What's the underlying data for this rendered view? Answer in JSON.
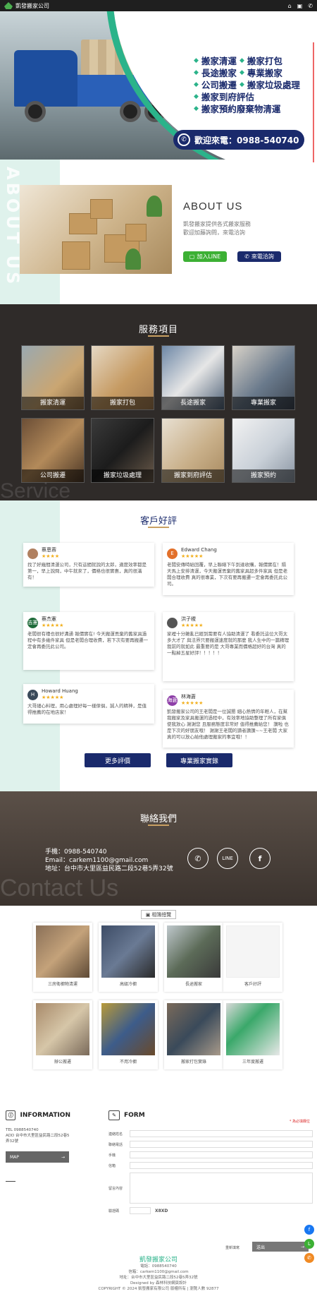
{
  "header": {
    "logo_text": "凱發搬家公司",
    "icons": [
      "home-icon",
      "gallery-icon",
      "share-icon"
    ]
  },
  "hero": {
    "services": [
      [
        "搬家清運",
        "搬家打包"
      ],
      [
        "長途搬家",
        "專業搬家"
      ],
      [
        "公司搬遷",
        "搬家垃圾處理"
      ],
      [
        "搬家到府評估"
      ],
      [
        "搬家預約廢棄物清運"
      ]
    ],
    "phone_label": "歡迎來電：0988-540740"
  },
  "about": {
    "watermark": "ABOUT US",
    "title": "ABOUT US",
    "desc_line1": "凱發搬家提供各式搬家服務",
    "desc_line2": "歡迎加藤詢問，來電洽詢",
    "line_button": "加入LINE",
    "call_button": "來電洽詢"
  },
  "services": {
    "title": "服務項目",
    "watermark": "Service",
    "items": [
      "搬家清運",
      "搬家打包",
      "長途搬家",
      "專業搬家",
      "公司搬遷",
      "搬家垃圾處理",
      "搬家到府評估",
      "搬家預約"
    ]
  },
  "reviews": {
    "title": "客戶好評",
    "items": [
      {
        "initial": "",
        "name": "蔡恩蓉",
        "stars": "★★★★",
        "text": "找了好幾間清運公司，只有這間就說的太郎，適度效率都是第一，早上說問，中午就來了，價格也很實惠，真的很滿有！"
      },
      {
        "initial": "E",
        "name": "Edward Chang",
        "stars": "★★★★★",
        "text": "老闆安傳時給回覆，早上聯絡下午到達收購，報價實在！隔天馬上安排清運，今天搬運丟棄的舊家具超多件家具 但是老闆合理收費 真的很專業，下次有要再搬遷一定會再委託此公司。"
      },
      {
        "initial": "吉憲",
        "name": "蔡杰憲",
        "stars": "★★★★★",
        "text": "老闆很有禮也很好溝通 報價實在! 今天搬運丟棄的舊家具過程中有多幾件家具 但是老闆合理收費，若下次有要再搬遷一定會再委託此公司。"
      },
      {
        "initial": "",
        "name": "洪子稷",
        "stars": "★★★★★",
        "text": "家裡十分雜亂已經到需要有人協助清運了 看委託這位大哥太多大才了 與法界只要搬運速度就的那麼 我人生中的一篇精理 我前的就如此 最重要的是 大哥專業而價格超好的台灣 真的一點掉五星好評！！！！！"
      },
      {
        "initial": "H",
        "name": "Howard Huang",
        "stars": "★★★★★",
        "text": "大哥細心料理，用心處理好每一樣傢俱，誠人的精神，是值得推薦的在地店家！"
      },
      {
        "initial": "海蒼",
        "name": "林海蒼",
        "stars": "★★★★★",
        "text": "凱發搬家公司的王老闆是一位誠懇 細心熱情的年輕人，在幫我搬家及家具搬運的過程中，有效率地協助整理了所有家俱 使我放心 謝謝您 且服務態度非常好 值得推薦給您！ 讚啦 也是下次的好朋友哦！ 謝謝王老闆的讀者讚讚~~王老闆 大家真的可以放心給他處理搬家的事宜哦！！"
      }
    ],
    "more_button": "更多評價",
    "cases_button": "專業搬家實錄"
  },
  "contact": {
    "title": "聯絡我們",
    "watermark": "Contact Us",
    "phone": "手機：0988-540740",
    "email": "Email：carkem1100@gmail.com",
    "address": "地址：台中市大里區益民路二段52巷5弄32號"
  },
  "gallery": {
    "tag": "相簿總覽",
    "items": [
      "三房衛櫥物清運",
      "高級冷櫥",
      "長途搬家",
      "客戶好評",
      "辦公搬遷",
      "不用冷櫥",
      "搬家打包實錄",
      "三年度搬遷"
    ]
  },
  "info": {
    "title": "INFORMATION",
    "tel": "TEL  0988540740",
    "add": "ADD 台中市大里區益民路二段52巷5弄32號",
    "map_button": "MAP"
  },
  "form": {
    "title": "FORM",
    "required_note": "* 為必填欄位",
    "fields": [
      "連絡姓名",
      "聯絡電話",
      "手機",
      "信箱",
      "留言內容"
    ],
    "captcha_label": "驗證碼",
    "captcha_code": "X8XD",
    "reset_label": "重新填寫",
    "send_label": "送出"
  },
  "footer": {
    "logo": "凱發搬家公司",
    "l1": "電話：0988540740",
    "l2": "信箱：carkem1100@gmail.com",
    "l3": "地址：台中市大里區益民路二段52巷5弄32號",
    "l4": "Designed by 森林科技網頁設計",
    "l5": "COPYRIGHT © 2024 凱發搬家有限公司 版權所有 | 瀏覽人數 92877"
  },
  "colors": {
    "navy": "#1a2a6c",
    "teal": "#2bb38a",
    "mint": "#dff2ec",
    "line_green": "#3cb034"
  }
}
